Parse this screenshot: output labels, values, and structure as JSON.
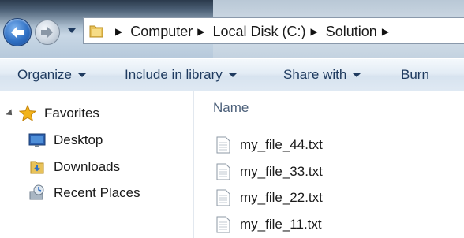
{
  "nav": {
    "back_icon": "back-arrow-icon",
    "forward_icon": "forward-arrow-icon",
    "history_icon": "chevron-down-icon"
  },
  "address": {
    "root_icon": "folder-icon",
    "crumbs": [
      "Computer",
      "Local Disk (C:)",
      "Solution"
    ]
  },
  "toolbar": {
    "organize_label": "Organize",
    "include_label": "Include in library",
    "share_label": "Share with",
    "burn_label": "Burn"
  },
  "navpane": {
    "favorites_label": "Favorites",
    "items": [
      {
        "label": "Desktop",
        "icon": "desktop-icon"
      },
      {
        "label": "Downloads",
        "icon": "downloads-folder-icon"
      },
      {
        "label": "Recent Places",
        "icon": "recent-places-icon"
      }
    ]
  },
  "content": {
    "column_name": "Name",
    "files": [
      "my_file_44.txt",
      "my_file_33.txt",
      "my_file_22.txt",
      "my_file_11.txt"
    ]
  },
  "colors": {
    "toolbar_text": "#1e3a5f",
    "header_text": "#4c607a",
    "accent_blue": "#2f6fc3"
  }
}
